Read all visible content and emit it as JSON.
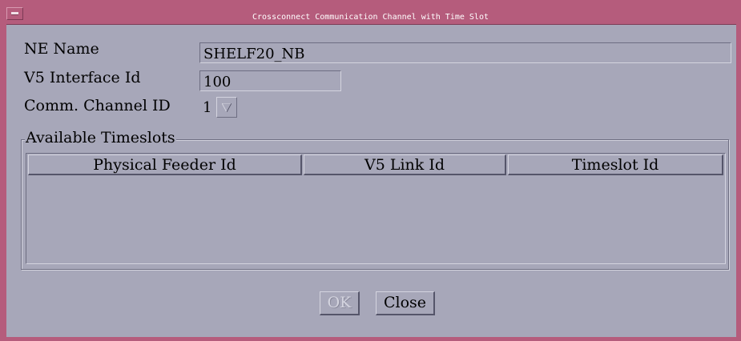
{
  "window": {
    "title": "Crossconnect Communication Channel with Time Slot"
  },
  "form": {
    "ne_name_label": "NE Name",
    "ne_name_value": "SHELF20_NB",
    "v5_interface_label": "V5 Interface Id",
    "v5_interface_value": "100",
    "comm_channel_label": "Comm. Channel ID",
    "comm_channel_value": "1"
  },
  "timeslots": {
    "group_title": "Available Timeslots",
    "columns": [
      "Physical Feeder Id",
      "V5 Link Id",
      "Timeslot Id"
    ],
    "rows": []
  },
  "buttons": {
    "ok_label": "OK",
    "ok_enabled": false,
    "close_label": "Close"
  },
  "colors": {
    "titlebar": "#b55c7c",
    "background": "#a7a7b9"
  }
}
